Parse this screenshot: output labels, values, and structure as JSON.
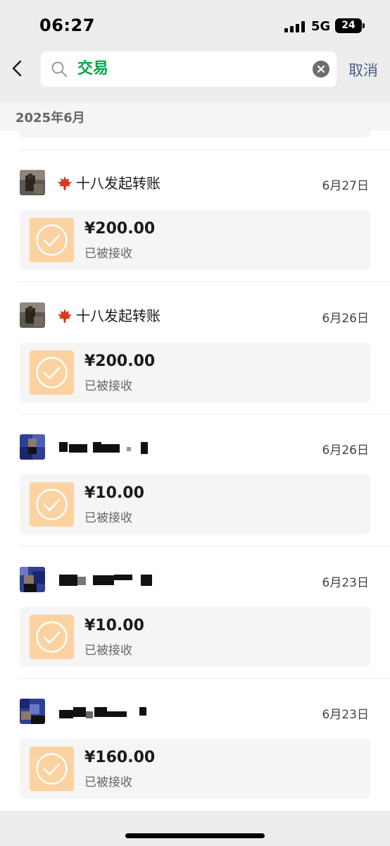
{
  "status_bar": {
    "time": "06:27",
    "network": "5G",
    "battery": "24"
  },
  "search": {
    "query": "交易",
    "cancel_label": "取消"
  },
  "month_header": "2025年6月",
  "colors": {
    "accent_green": "#07a44a",
    "link_blue": "#4a5f8a",
    "transfer_orange": "#fcd2a0"
  },
  "transactions": [
    {
      "sender": "十八发起转账",
      "date": "6月27日",
      "amount": "¥200.00",
      "status": "已被接收",
      "avatar_icon": "photo-avatar",
      "sender_icon": "maple-leaf-icon"
    },
    {
      "sender": "十八发起转账",
      "date": "6月26日",
      "amount": "¥200.00",
      "status": "已被接收",
      "avatar_icon": "photo-avatar",
      "sender_icon": "maple-leaf-icon"
    },
    {
      "sender": "",
      "date": "6月26日",
      "amount": "¥10.00",
      "status": "已被接收",
      "avatar_icon": "pixelated-avatar"
    },
    {
      "sender": "",
      "date": "6月23日",
      "amount": "¥10.00",
      "status": "已被接收",
      "avatar_icon": "pixelated-avatar"
    },
    {
      "sender": "",
      "date": "6月23日",
      "amount": "¥160.00",
      "status": "已被接收",
      "avatar_icon": "pixelated-avatar"
    }
  ]
}
